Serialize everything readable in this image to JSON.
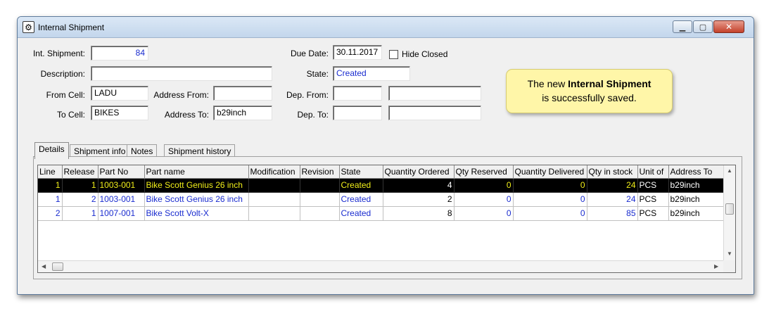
{
  "window": {
    "title": "Internal Shipment",
    "app_icon": "gear-icon",
    "controls": {
      "minimize": "minimize-icon",
      "maximize": "maximize-icon",
      "close": "close-icon"
    }
  },
  "form": {
    "int_shipment_label": "Int. Shipment:",
    "int_shipment_value": "84",
    "description_label": "Description:",
    "description_value": "",
    "from_cell_label": "From Cell:",
    "from_cell_value": "LADU",
    "to_cell_label": "To Cell:",
    "to_cell_value": "BIKES",
    "address_from_label": "Address From:",
    "address_from_value": "",
    "address_to_label": "Address To:",
    "address_to_value": "b29inch",
    "due_date_label": "Due Date:",
    "due_date_value": "30.11.2017",
    "hide_closed_label": "Hide Closed",
    "hide_closed_checked": false,
    "state_label": "State:",
    "state_value": "Created",
    "dep_from_label": "Dep. From:",
    "dep_from_value_1": "",
    "dep_from_value_2": "",
    "dep_to_label": "Dep. To:",
    "dep_to_value_1": "",
    "dep_to_value_2": ""
  },
  "tooltip": {
    "prefix": "The new ",
    "bold": "Internal Shipment",
    "line2": "is successfully saved."
  },
  "tabs": [
    {
      "label": "Details",
      "active": true
    },
    {
      "label": "Shipment info",
      "active": false
    },
    {
      "label": "Notes",
      "active": false
    },
    {
      "label": "Shipment history",
      "active": false
    }
  ],
  "grid": {
    "columns": [
      "Line",
      "Release",
      "Part No",
      "Part name",
      "Modification",
      "Revision",
      "State",
      "Quantity Ordered",
      "Qty Reserved",
      "Quantity Delivered",
      "Qty in stock",
      "Unit of",
      "Address To"
    ],
    "rows": [
      [
        "1",
        "1",
        "1003-001",
        "Bike Scott Genius 26 inch",
        "",
        "",
        "Created",
        "4",
        "0",
        "0",
        "24",
        "PCS",
        "b29inch"
      ],
      [
        "1",
        "2",
        "1003-001",
        "Bike Scott Genius 26 inch",
        "",
        "",
        "Created",
        "2",
        "0",
        "0",
        "24",
        "PCS",
        "b29inch"
      ],
      [
        "2",
        "1",
        "1007-001",
        "Bike Scott Volt-X",
        "",
        "",
        "Created",
        "8",
        "0",
        "0",
        "85",
        "PCS",
        "b29inch"
      ]
    ],
    "selected_row": 0
  },
  "colors": {
    "value_text": "#1a2ccf",
    "selected_row_bg": "#000000",
    "selected_row_text": "#f0ee1a",
    "tooltip_bg": "#fff6a8"
  }
}
